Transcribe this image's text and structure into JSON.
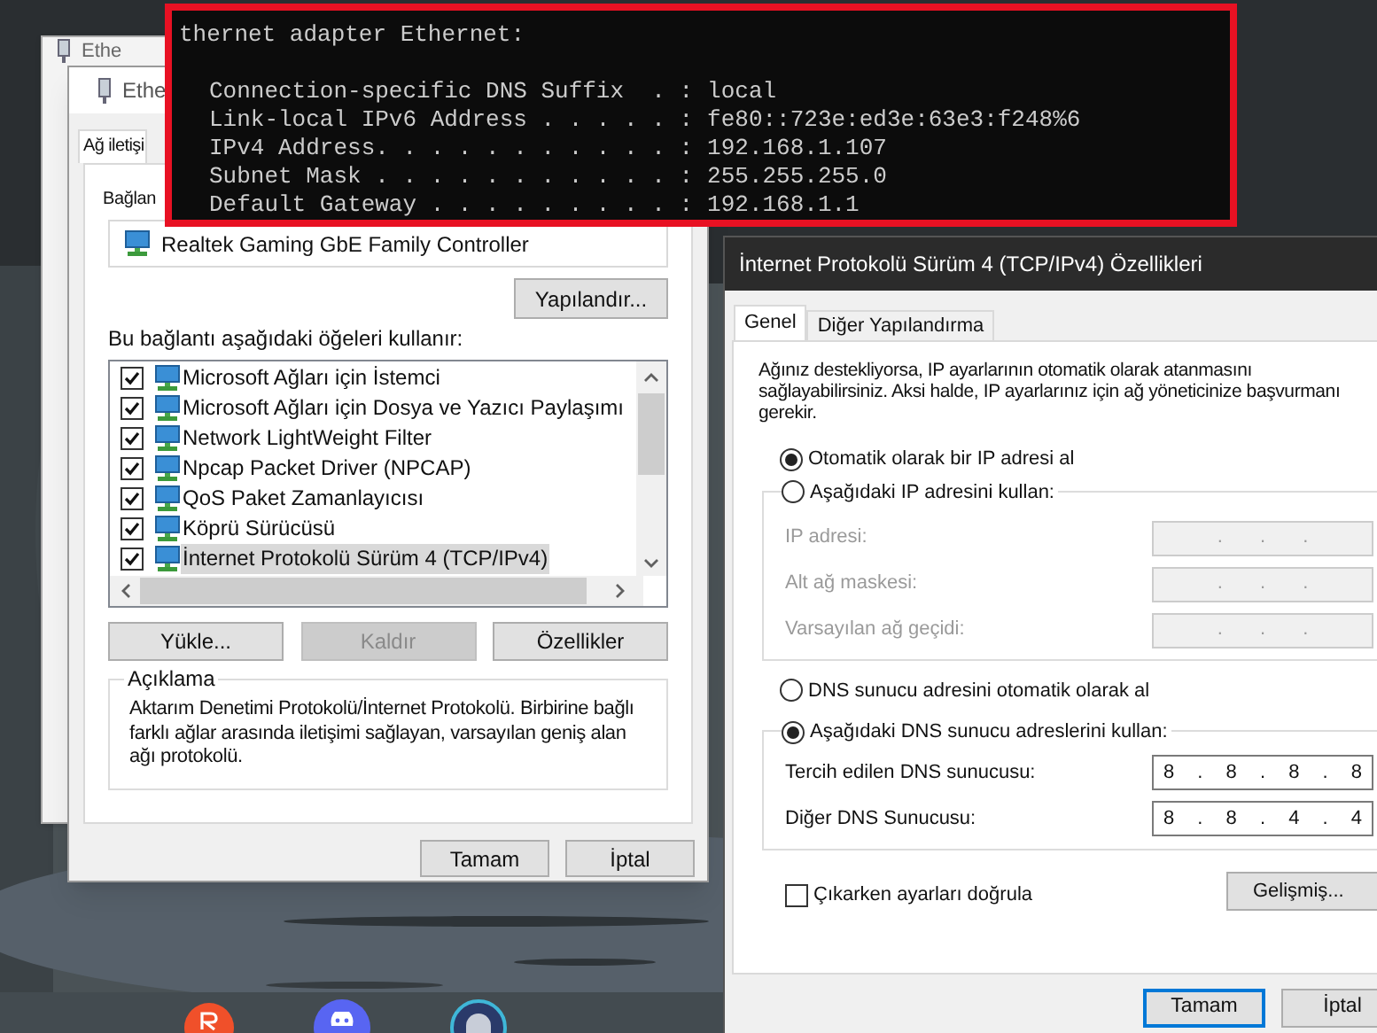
{
  "back_window": {
    "title": "Ethe"
  },
  "adapter_window": {
    "title": "Ethe",
    "tab": "Ağ iletişi",
    "connect_label": "Bağlan",
    "adapter": "Realtek Gaming GbE Family Controller",
    "configure_button": "Yapılandır...",
    "items_label": "Bu bağlantı aşağıdaki öğeleri kullanır:",
    "items": [
      {
        "label": "Microsoft Ağları için İstemci",
        "checked": true,
        "selected": false
      },
      {
        "label": "Microsoft Ağları için Dosya ve Yazıcı Paylaşımı",
        "checked": true,
        "selected": false
      },
      {
        "label": "Network LightWeight Filter",
        "checked": true,
        "selected": false
      },
      {
        "label": "Npcap Packet Driver (NPCAP)",
        "checked": true,
        "selected": false
      },
      {
        "label": "QoS Paket Zamanlayıcısı",
        "checked": true,
        "selected": false
      },
      {
        "label": "Köprü Sürücüsü",
        "checked": true,
        "selected": false
      },
      {
        "label": "İnternet Protokolü Sürüm 4 (TCP/IPv4)",
        "checked": true,
        "selected": true
      }
    ],
    "buttons": [
      {
        "label": "Yükle...",
        "disabled": false
      },
      {
        "label": "Kaldır",
        "disabled": true
      },
      {
        "label": "Özellikler",
        "disabled": false
      }
    ],
    "description": {
      "title": "Açıklama",
      "text": "Aktarım Denetimi Protokolü/İnternet Protokolü. Birbirine bağlı farklı ağlar arasında iletişimi sağlayan, varsayılan geniş alan ağı protokolü."
    },
    "footer_buttons": [
      "Tamam",
      "İptal"
    ]
  },
  "terminal": {
    "heading": "thernet adapter Ethernet:",
    "lines": [
      {
        "label": "Connection-specific DNS Suffix  . :",
        "value": "local"
      },
      {
        "label": "Link-local IPv6 Address . . . . . :",
        "value": "fe80::723e:ed3e:63e3:f248%6"
      },
      {
        "label": "IPv4 Address. . . . . . . . . . . :",
        "value": "192.168.1.107"
      },
      {
        "label": "Subnet Mask . . . . . . . . . . . :",
        "value": "255.255.255.0"
      },
      {
        "label": "Default Gateway . . . . . . . . . :",
        "value": "192.168.1.1"
      }
    ]
  },
  "ipv4_dialog": {
    "title": "İnternet Protokolü Sürüm 4 (TCP/IPv4) Özellikleri",
    "tabs": [
      {
        "label": "Genel",
        "selected": true
      },
      {
        "label": "Diğer Yapılandırma",
        "selected": false
      }
    ],
    "intro_lines": [
      "Ağınız destekliyorsa, IP ayarlarının otomatik olarak atanmasını",
      "sağlayabilirsiniz. Aksi halde, IP ayarlarınız için ağ yöneticinize başvurmanı",
      "gerekir."
    ],
    "ip_options": [
      {
        "label": "Otomatik olarak bir IP adresi al",
        "selected": true
      },
      {
        "label": "Aşağıdaki IP adresini kullan:",
        "selected": false
      }
    ],
    "ip_fields": [
      {
        "label": "IP adresi:",
        "value": ". . .",
        "disabled": true
      },
      {
        "label": "Alt ağ maskesi:",
        "value": ". . .",
        "disabled": true
      },
      {
        "label": "Varsayılan ağ geçidi:",
        "value": ". . .",
        "disabled": true
      }
    ],
    "dns_options": [
      {
        "label": "DNS sunucu adresini otomatik olarak al",
        "selected": false
      },
      {
        "label": "Aşağıdaki DNS sunucu adreslerini kullan:",
        "selected": true
      }
    ],
    "dns_fields": [
      {
        "label": "Tercih edilen DNS sunucusu:",
        "value": "8 . 8 . 8 . 8",
        "disabled": false
      },
      {
        "label": "Diğer DNS Sunucusu:",
        "value": "8 . 8 . 4 . 4",
        "disabled": false
      }
    ],
    "validate": {
      "label": "Çıkarken ayarları doğrula",
      "checked": false
    },
    "advanced_button": "Gelişmiş...",
    "footer_buttons": [
      {
        "label": "Tamam",
        "focused": true
      },
      {
        "label": "İptal",
        "focused": false
      }
    ]
  }
}
